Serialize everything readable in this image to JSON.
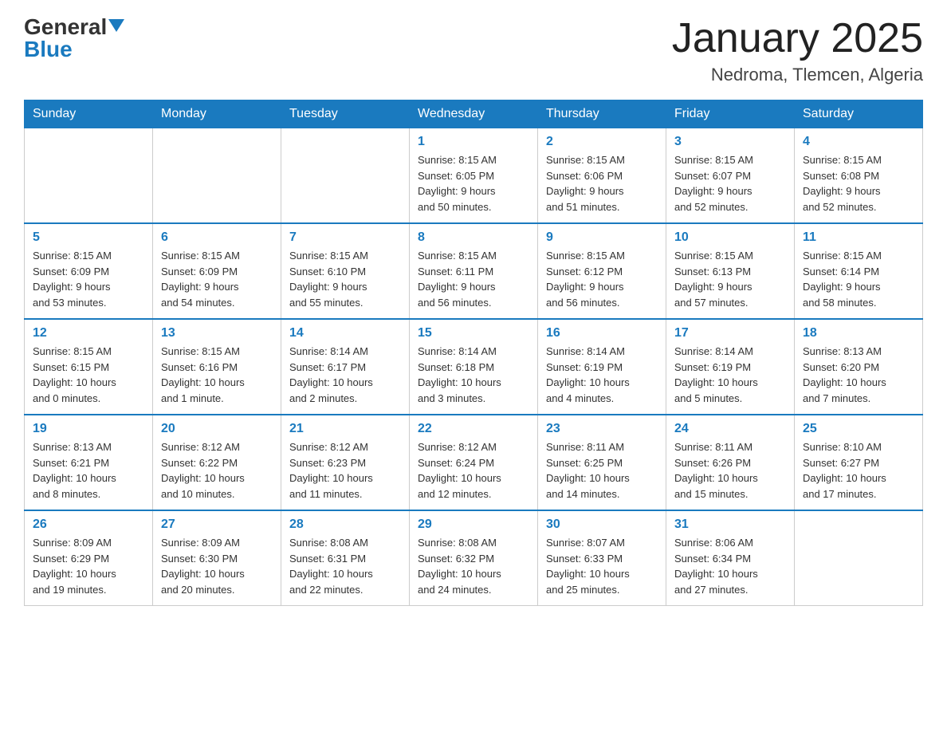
{
  "header": {
    "logo_general": "General",
    "logo_blue": "Blue",
    "month_title": "January 2025",
    "location": "Nedroma, Tlemcen, Algeria"
  },
  "days_of_week": [
    "Sunday",
    "Monday",
    "Tuesday",
    "Wednesday",
    "Thursday",
    "Friday",
    "Saturday"
  ],
  "weeks": [
    [
      {
        "day": "",
        "info": ""
      },
      {
        "day": "",
        "info": ""
      },
      {
        "day": "",
        "info": ""
      },
      {
        "day": "1",
        "info": "Sunrise: 8:15 AM\nSunset: 6:05 PM\nDaylight: 9 hours\nand 50 minutes."
      },
      {
        "day": "2",
        "info": "Sunrise: 8:15 AM\nSunset: 6:06 PM\nDaylight: 9 hours\nand 51 minutes."
      },
      {
        "day": "3",
        "info": "Sunrise: 8:15 AM\nSunset: 6:07 PM\nDaylight: 9 hours\nand 52 minutes."
      },
      {
        "day": "4",
        "info": "Sunrise: 8:15 AM\nSunset: 6:08 PM\nDaylight: 9 hours\nand 52 minutes."
      }
    ],
    [
      {
        "day": "5",
        "info": "Sunrise: 8:15 AM\nSunset: 6:09 PM\nDaylight: 9 hours\nand 53 minutes."
      },
      {
        "day": "6",
        "info": "Sunrise: 8:15 AM\nSunset: 6:09 PM\nDaylight: 9 hours\nand 54 minutes."
      },
      {
        "day": "7",
        "info": "Sunrise: 8:15 AM\nSunset: 6:10 PM\nDaylight: 9 hours\nand 55 minutes."
      },
      {
        "day": "8",
        "info": "Sunrise: 8:15 AM\nSunset: 6:11 PM\nDaylight: 9 hours\nand 56 minutes."
      },
      {
        "day": "9",
        "info": "Sunrise: 8:15 AM\nSunset: 6:12 PM\nDaylight: 9 hours\nand 56 minutes."
      },
      {
        "day": "10",
        "info": "Sunrise: 8:15 AM\nSunset: 6:13 PM\nDaylight: 9 hours\nand 57 minutes."
      },
      {
        "day": "11",
        "info": "Sunrise: 8:15 AM\nSunset: 6:14 PM\nDaylight: 9 hours\nand 58 minutes."
      }
    ],
    [
      {
        "day": "12",
        "info": "Sunrise: 8:15 AM\nSunset: 6:15 PM\nDaylight: 10 hours\nand 0 minutes."
      },
      {
        "day": "13",
        "info": "Sunrise: 8:15 AM\nSunset: 6:16 PM\nDaylight: 10 hours\nand 1 minute."
      },
      {
        "day": "14",
        "info": "Sunrise: 8:14 AM\nSunset: 6:17 PM\nDaylight: 10 hours\nand 2 minutes."
      },
      {
        "day": "15",
        "info": "Sunrise: 8:14 AM\nSunset: 6:18 PM\nDaylight: 10 hours\nand 3 minutes."
      },
      {
        "day": "16",
        "info": "Sunrise: 8:14 AM\nSunset: 6:19 PM\nDaylight: 10 hours\nand 4 minutes."
      },
      {
        "day": "17",
        "info": "Sunrise: 8:14 AM\nSunset: 6:19 PM\nDaylight: 10 hours\nand 5 minutes."
      },
      {
        "day": "18",
        "info": "Sunrise: 8:13 AM\nSunset: 6:20 PM\nDaylight: 10 hours\nand 7 minutes."
      }
    ],
    [
      {
        "day": "19",
        "info": "Sunrise: 8:13 AM\nSunset: 6:21 PM\nDaylight: 10 hours\nand 8 minutes."
      },
      {
        "day": "20",
        "info": "Sunrise: 8:12 AM\nSunset: 6:22 PM\nDaylight: 10 hours\nand 10 minutes."
      },
      {
        "day": "21",
        "info": "Sunrise: 8:12 AM\nSunset: 6:23 PM\nDaylight: 10 hours\nand 11 minutes."
      },
      {
        "day": "22",
        "info": "Sunrise: 8:12 AM\nSunset: 6:24 PM\nDaylight: 10 hours\nand 12 minutes."
      },
      {
        "day": "23",
        "info": "Sunrise: 8:11 AM\nSunset: 6:25 PM\nDaylight: 10 hours\nand 14 minutes."
      },
      {
        "day": "24",
        "info": "Sunrise: 8:11 AM\nSunset: 6:26 PM\nDaylight: 10 hours\nand 15 minutes."
      },
      {
        "day": "25",
        "info": "Sunrise: 8:10 AM\nSunset: 6:27 PM\nDaylight: 10 hours\nand 17 minutes."
      }
    ],
    [
      {
        "day": "26",
        "info": "Sunrise: 8:09 AM\nSunset: 6:29 PM\nDaylight: 10 hours\nand 19 minutes."
      },
      {
        "day": "27",
        "info": "Sunrise: 8:09 AM\nSunset: 6:30 PM\nDaylight: 10 hours\nand 20 minutes."
      },
      {
        "day": "28",
        "info": "Sunrise: 8:08 AM\nSunset: 6:31 PM\nDaylight: 10 hours\nand 22 minutes."
      },
      {
        "day": "29",
        "info": "Sunrise: 8:08 AM\nSunset: 6:32 PM\nDaylight: 10 hours\nand 24 minutes."
      },
      {
        "day": "30",
        "info": "Sunrise: 8:07 AM\nSunset: 6:33 PM\nDaylight: 10 hours\nand 25 minutes."
      },
      {
        "day": "31",
        "info": "Sunrise: 8:06 AM\nSunset: 6:34 PM\nDaylight: 10 hours\nand 27 minutes."
      },
      {
        "day": "",
        "info": ""
      }
    ]
  ]
}
